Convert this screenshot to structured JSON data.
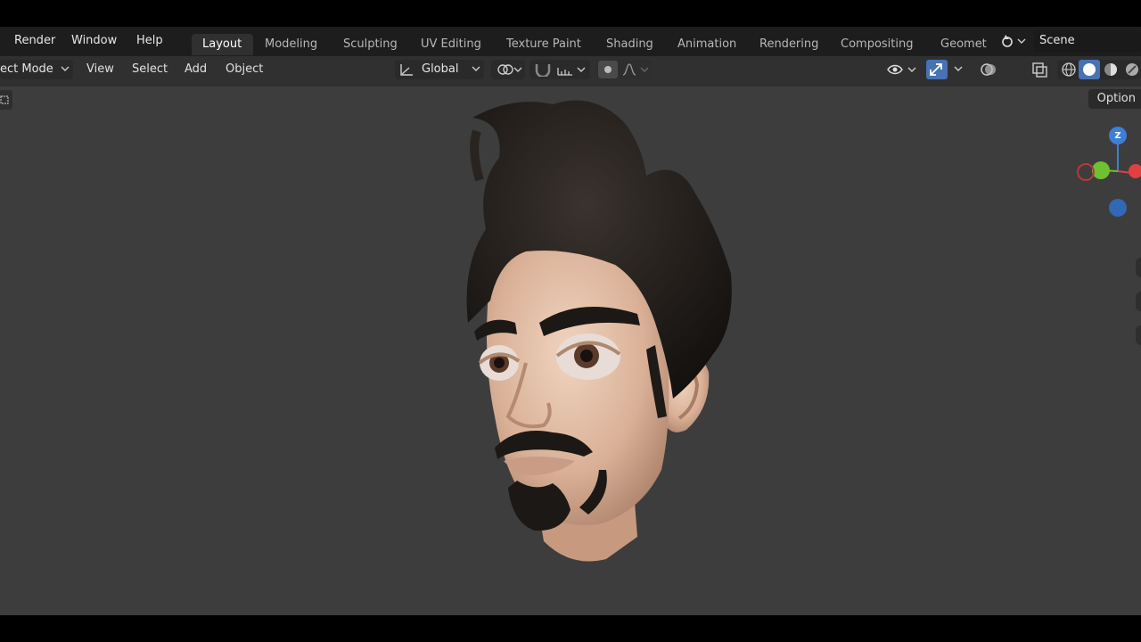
{
  "topbar": {
    "menus": [
      "Render",
      "Window",
      "Help"
    ],
    "workspace_tabs": [
      "Layout",
      "Modeling",
      "Sculpting",
      "UV Editing",
      "Texture Paint",
      "Shading",
      "Animation",
      "Rendering",
      "Compositing",
      "Geomet"
    ],
    "active_tab": "Layout",
    "scene_label": "Scene"
  },
  "viewport_header": {
    "mode_label": "ect Mode",
    "menus": [
      "View",
      "Select",
      "Add",
      "Object"
    ],
    "orientation_label": "Global"
  },
  "sidebar": {
    "options_label": "Option"
  },
  "gizmo": {
    "z_label": "Z"
  },
  "icons": {
    "mode": "chevron-down-icon",
    "orientation": "transform-orientation-icon",
    "pivot": "pivot-point-icon",
    "snap": "snap-magnet-icon",
    "snap_target": "snap-increment-icon",
    "proportional": "proportional-edit-icon",
    "falloff": "falloff-curve-icon",
    "visibility": "eye-visibility-icon",
    "gizmo_toggle": "gizmo-arrow-icon",
    "overlay": "overlay-icon",
    "xray": "xray-icon",
    "shading_wire": "wireframe-shading-icon",
    "shading_solid": "solid-shading-icon",
    "shading_material": "material-shading-icon",
    "shading_render": "rendered-shading-icon",
    "scene": "scene-icon"
  },
  "colors": {
    "viewport_bg": "#3d3d3d",
    "header_bg": "#303030",
    "topbar_bg": "#1d1d1d",
    "axis_x": "#e04040",
    "axis_y": "#6ec130",
    "axis_z": "#3d7ed6",
    "hair": "#1e1a17",
    "skin": "#e3bfa6"
  }
}
